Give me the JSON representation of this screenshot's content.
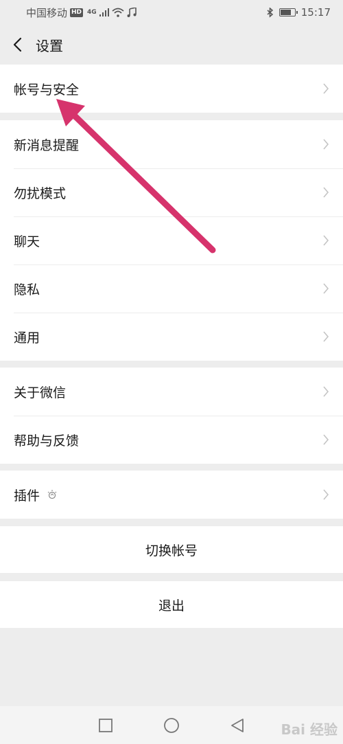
{
  "status_bar": {
    "carrier": "中国移动",
    "hd_badge": "HD",
    "network": "4G",
    "time": "15:17"
  },
  "header": {
    "title": "设置"
  },
  "groups": [
    {
      "items": [
        {
          "label": "帐号与安全"
        }
      ]
    },
    {
      "items": [
        {
          "label": "新消息提醒"
        },
        {
          "label": "勿扰模式"
        },
        {
          "label": "聊天"
        },
        {
          "label": "隐私"
        },
        {
          "label": "通用"
        }
      ]
    },
    {
      "items": [
        {
          "label": "关于微信"
        },
        {
          "label": "帮助与反馈"
        }
      ]
    },
    {
      "items": [
        {
          "label": "插件"
        }
      ]
    }
  ],
  "actions": {
    "switch_account": "切换帐号",
    "logout": "退出"
  },
  "watermark": "Bai 经验",
  "colors": {
    "background": "#ededed",
    "card": "#ffffff",
    "annotation_arrow": "#d6336c"
  },
  "icons": {
    "back": "chevron-left-icon",
    "row_chevron": "chevron-right-icon",
    "plugin": "plugin-bulb-icon",
    "bluetooth": "bluetooth-icon",
    "wifi": "wifi-icon",
    "music": "music-note-icon"
  }
}
